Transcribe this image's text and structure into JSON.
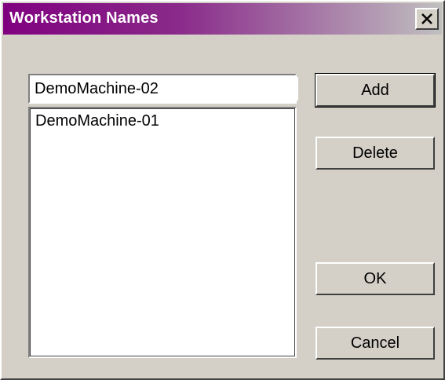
{
  "window": {
    "title": "Workstation Names"
  },
  "input": {
    "value": "DemoMachine-02"
  },
  "list": {
    "items": [
      {
        "label": "DemoMachine-01"
      }
    ]
  },
  "buttons": {
    "add": "Add",
    "delete": "Delete",
    "ok": "OK",
    "cancel": "Cancel"
  },
  "icons": {
    "close": "close-icon"
  }
}
